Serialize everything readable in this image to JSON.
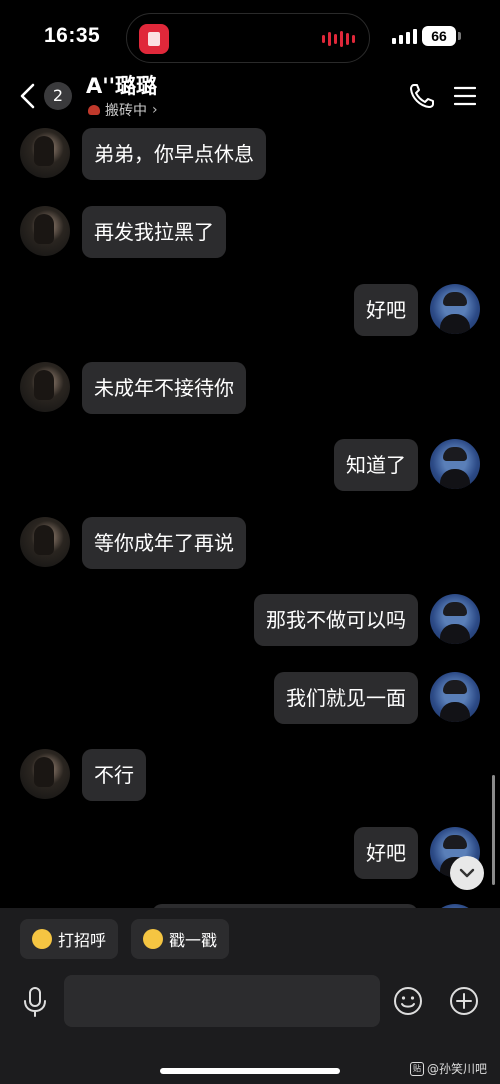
{
  "status_bar": {
    "time": "16:35",
    "battery": "66"
  },
  "header": {
    "unread_count": "2",
    "contact_name": "A''璐璐",
    "status_text": "搬砖中"
  },
  "messages": [
    {
      "side": "her",
      "text": "弟弟，你早点休息"
    },
    {
      "side": "her",
      "text": "再发我拉黑了"
    },
    {
      "side": "me",
      "text": "好吧"
    },
    {
      "side": "her",
      "text": "未成年不接待你"
    },
    {
      "side": "me",
      "text": "知道了"
    },
    {
      "side": "her",
      "text": "等你成年了再说"
    },
    {
      "side": "me",
      "text": "那我不做可以吗"
    },
    {
      "side": "me",
      "text": "我们就见一面"
    },
    {
      "side": "her",
      "text": "不行"
    },
    {
      "side": "me",
      "text": "好吧"
    }
  ],
  "quick_replies": [
    {
      "label": "打招呼",
      "icon": "wave-emoji-icon"
    },
    {
      "label": "戳一戳",
      "icon": "poke-emoji-icon"
    }
  ],
  "composer": {
    "input_value": "",
    "placeholder": ""
  },
  "watermark": "@孙笑川吧",
  "colors": {
    "background": "#000000",
    "bubble": "#2c2c2e",
    "panel": "#1c1c1e",
    "accent": "#e0283a"
  }
}
